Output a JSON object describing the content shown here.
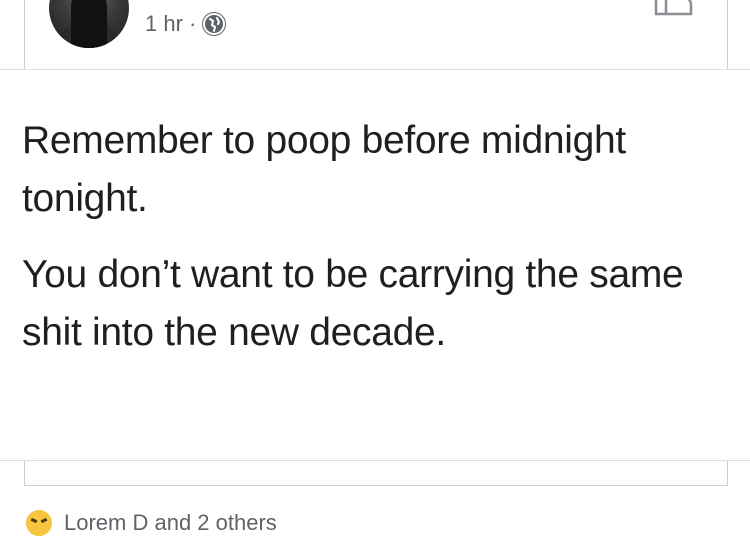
{
  "post": {
    "author_fragment": "· · · ·  · · · · · · · ·",
    "timestamp": "1 hr ·",
    "audience_icon": "globe-icon",
    "paragraphs": [
      "Remember to poop before midnight tonight.",
      "You don’t want to be carrying the same shit into the new decade."
    ]
  },
  "reactions": {
    "icon": "haha-reaction-icon",
    "summary": "Lorem D  and 2 others"
  }
}
